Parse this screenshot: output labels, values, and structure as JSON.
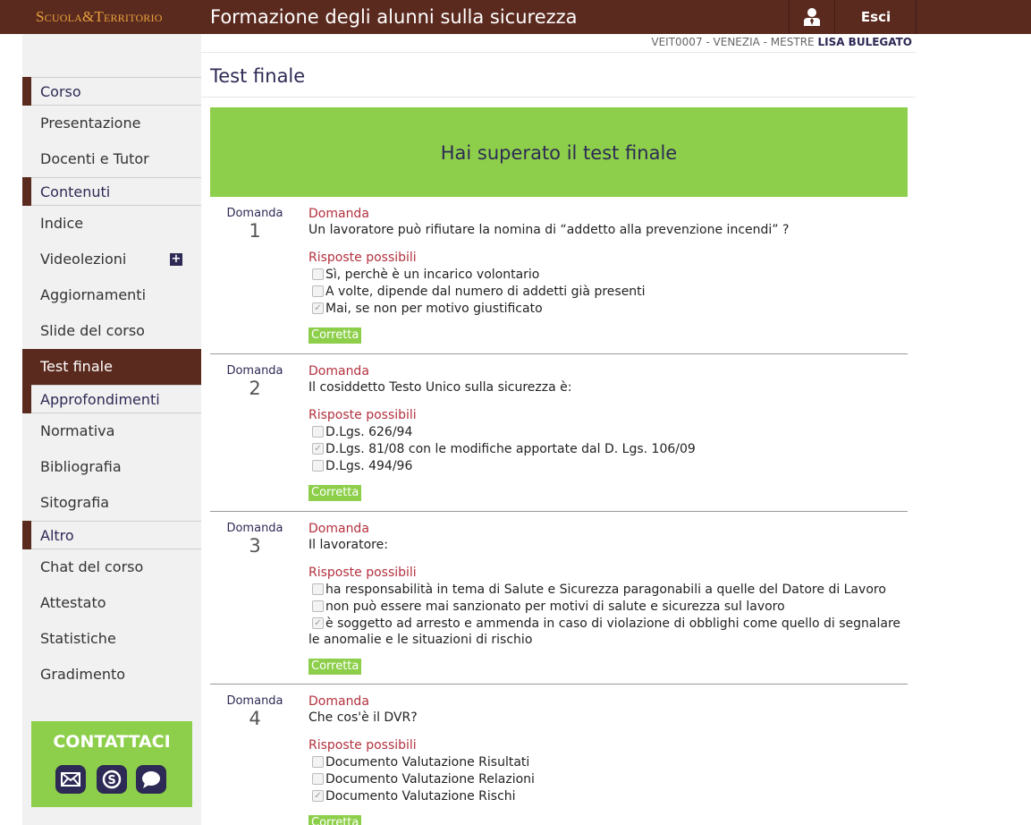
{
  "header": {
    "logo": "Scuola&Territorio",
    "title": "Formazione degli alunni sulla sicurezza",
    "logout_label": "Esci"
  },
  "userline": {
    "school": "VEIT0007 - VENEZIA - MESTRE",
    "user": "LISA BULEGATO"
  },
  "sidebar": {
    "sections": [
      {
        "label": "Corso",
        "items": [
          "Presentazione",
          "Docenti e Tutor"
        ]
      },
      {
        "label": "Contenuti",
        "items": [
          "Indice",
          "Videolezioni",
          "Aggiornamenti",
          "Slide del corso",
          "Test finale"
        ]
      },
      {
        "label": "Approfondimenti",
        "items": [
          "Normativa",
          "Bibliografia",
          "Sitografia"
        ]
      },
      {
        "label": "Altro",
        "items": [
          "Chat del corso",
          "Attestato",
          "Statistiche",
          "Gradimento"
        ]
      }
    ],
    "active_item": "Test finale",
    "contact_title": "CONTATTACI"
  },
  "main": {
    "page_title": "Test finale",
    "banner": "Hai superato il test finale",
    "question_label": "Domanda",
    "answers_label": "Risposte possibili",
    "correct_label": "Corretta",
    "questions": [
      {
        "number": "1",
        "text": "Un lavoratore può rifiutare la nomina di “addetto alla prevenzione incendi” ?",
        "answers": [
          {
            "text": "Sì, perchè è un incarico volontario",
            "checked": false
          },
          {
            "text": "A volte, dipende dal numero di addetti già presenti",
            "checked": false
          },
          {
            "text": "Mai, se non per motivo giustificato",
            "checked": true
          }
        ]
      },
      {
        "number": "2",
        "text": "Il cosiddetto Testo Unico sulla sicurezza è:",
        "answers": [
          {
            "text": "D.Lgs. 626/94",
            "checked": false
          },
          {
            "text": "D.Lgs. 81/08 con le modifiche apportate dal D. Lgs. 106/09",
            "checked": true
          },
          {
            "text": "D.Lgs. 494/96",
            "checked": false
          }
        ]
      },
      {
        "number": "3",
        "text": "Il lavoratore:",
        "answers": [
          {
            "text": "ha responsabilità in tema di Salute e Sicurezza paragonabili a quelle del Datore di Lavoro",
            "checked": false
          },
          {
            "text": "non può essere mai sanzionato per motivi di salute e sicurezza sul lavoro",
            "checked": false
          },
          {
            "text": "è soggetto ad arresto e ammenda in caso di violazione di obblighi come quello di segnalare le anomalie e le situazioni di rischio",
            "checked": true
          }
        ]
      },
      {
        "number": "4",
        "text": "Che cos'è il DVR?",
        "answers": [
          {
            "text": "Documento Valutazione Risultati",
            "checked": false
          },
          {
            "text": "Documento Valutazione Relazioni",
            "checked": false
          },
          {
            "text": "Documento Valutazione Rischi",
            "checked": true
          }
        ]
      }
    ]
  },
  "colors": {
    "brand_brown": "#5b2a1f",
    "accent_green": "#8dcf4a",
    "navy": "#2d2a55",
    "question_red": "#b3313f"
  }
}
